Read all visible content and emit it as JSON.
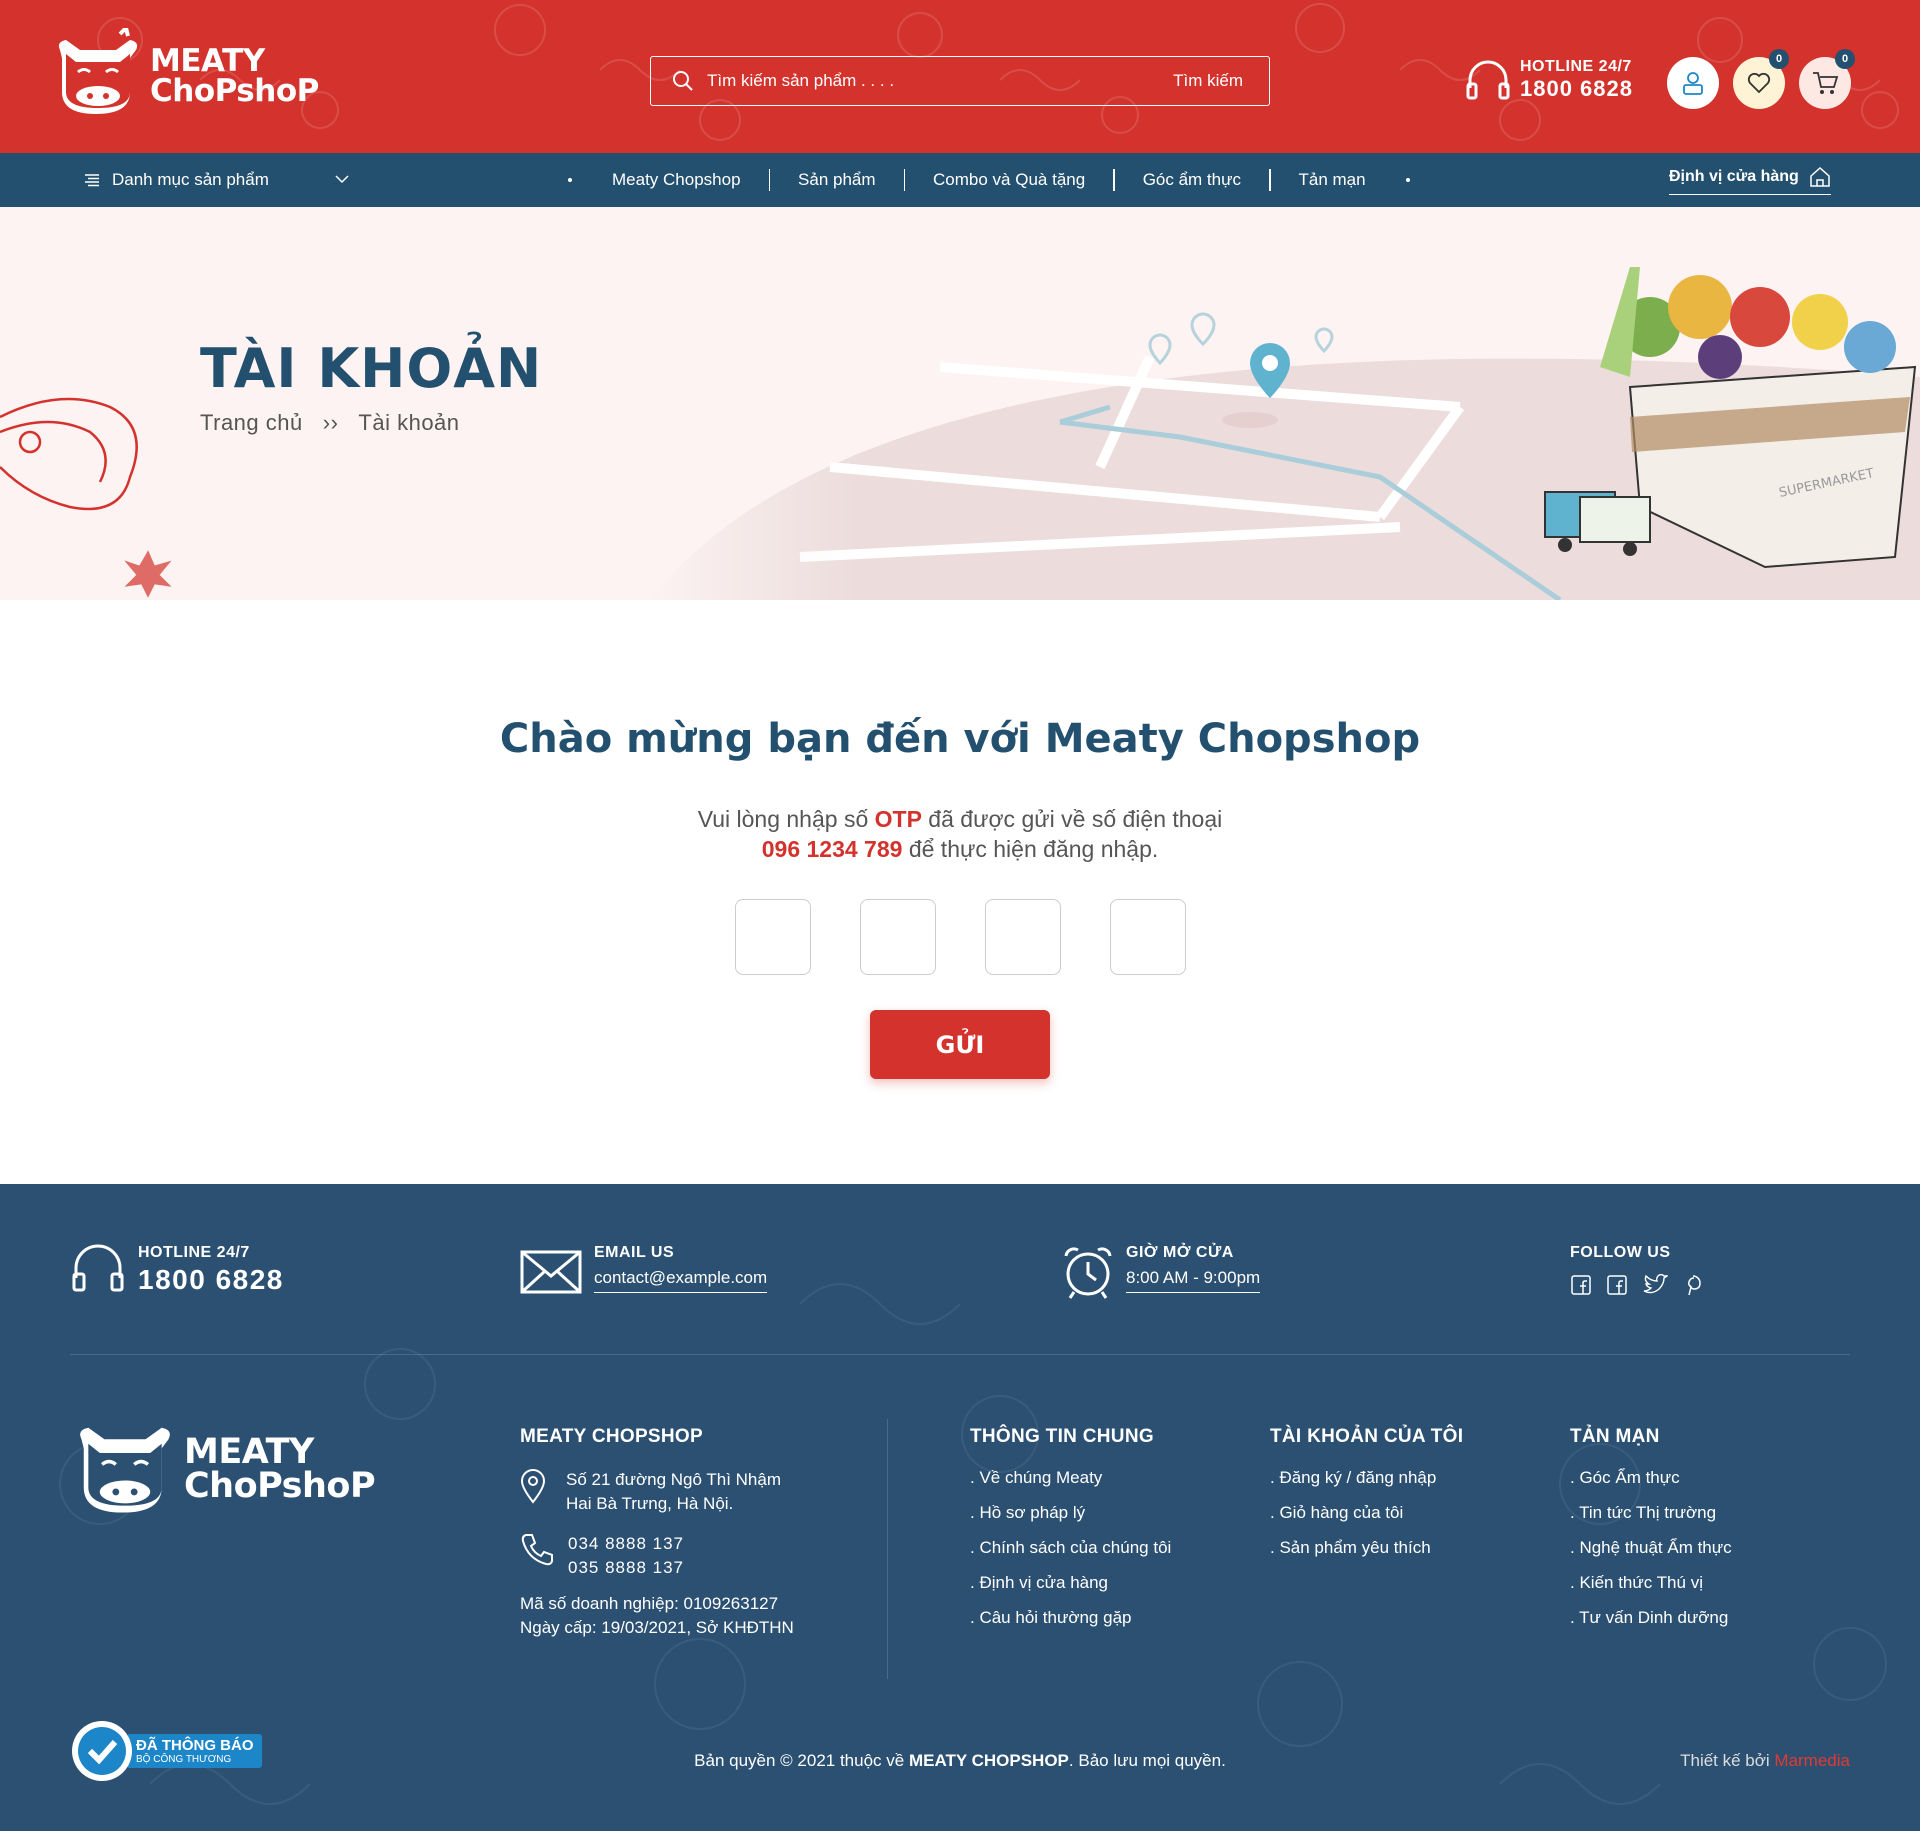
{
  "header": {
    "logo_line1": "MEATY",
    "logo_line2": "ChoPshoP",
    "search_placeholder": "Tìm kiếm sản phẩm . . . .",
    "search_button": "Tìm kiếm",
    "hotline_label": "HOTLINE 24/7",
    "hotline_number": "1800 6828",
    "wishlist_count": "0",
    "cart_count": "0"
  },
  "nav": {
    "category_label": "Danh mục sản phẩm",
    "items": [
      {
        "label": "Meaty Chopshop"
      },
      {
        "label": "Sản phẩm"
      },
      {
        "label": "Combo và Quà tặng"
      },
      {
        "label": "Góc ẩm thực"
      },
      {
        "label": "Tản mạn"
      }
    ],
    "store_locator": "Định vị cửa hàng"
  },
  "banner": {
    "title": "TÀI KHOẢN",
    "breadcrumb_home": "Trang chủ",
    "breadcrumb_current": "Tài khoản",
    "illustration_label": "SUPERMARKET"
  },
  "main": {
    "welcome": "Chào mừng bạn đến với Meaty Chopshop",
    "msg_part1": "Vui lòng nhập số ",
    "msg_otp": "OTP",
    "msg_part2": " đã được gửi về số điện thoại",
    "msg_phone": "096 1234 789",
    "msg_part3": " để thực hiện đăng nhập.",
    "otp_values": [
      "",
      "",
      "",
      ""
    ],
    "send_button": "GỬI"
  },
  "footer": {
    "hotline_label": "HOTLINE 24/7",
    "hotline_number": "1800 6828",
    "email_label": "EMAIL US",
    "email_value": "contact@example.com",
    "hours_label": "GIỜ MỞ CỬA",
    "hours_value": "8:00 AM  -  9:00pm",
    "follow_label": "FOLLOW US",
    "company": {
      "title": "MEATY CHOPSHOP",
      "address_line1": "Số 21 đường Ngô Thì Nhậm",
      "address_line2": "Hai Bà Trưng, Hà Nội.",
      "phone1": "034 8888 137",
      "phone2": "035 8888 137",
      "business_id": "Mã số doanh nghiệp: 0109263127",
      "issued": "Ngày cấp: 19/03/2021, Sở KHĐTHN"
    },
    "columns": [
      {
        "title": "THÔNG TIN CHUNG",
        "items": [
          "Về chúng Meaty",
          "Hồ sơ pháp lý",
          "Chính sách của chúng tôi",
          "Định vị cửa hàng",
          "Câu hỏi thường gặp"
        ]
      },
      {
        "title": "TÀI KHOẢN CỦA TÔI",
        "items": [
          "Đăng ký / đăng nhập",
          "Giỏ hàng của tôi",
          "Sản phẩm yêu thích"
        ]
      },
      {
        "title": "TẢN MẠN",
        "items": [
          "Góc Ẩm thực",
          "Tin tức Thị trường",
          "Nghệ thuật Ẩm thực",
          "Kiến thức Thú vị",
          "Tư vấn Dinh dưỡng"
        ]
      }
    ],
    "badge_line1": "ĐÃ THÔNG BÁO",
    "badge_line2": "BỘ CÔNG THƯƠNG",
    "copyright_pre": "Bản quyền © 2021 thuộc về ",
    "copyright_brand": "MEATY CHOPSHOP",
    "copyright_post": ". Bảo lưu mọi quyền.",
    "design_pre": "Thiết kế bởi ",
    "design_brand": "Marmedia"
  },
  "colors": {
    "brand_red": "#d4322c",
    "brand_blue": "#24506f",
    "footer_blue": "#2b5072"
  }
}
